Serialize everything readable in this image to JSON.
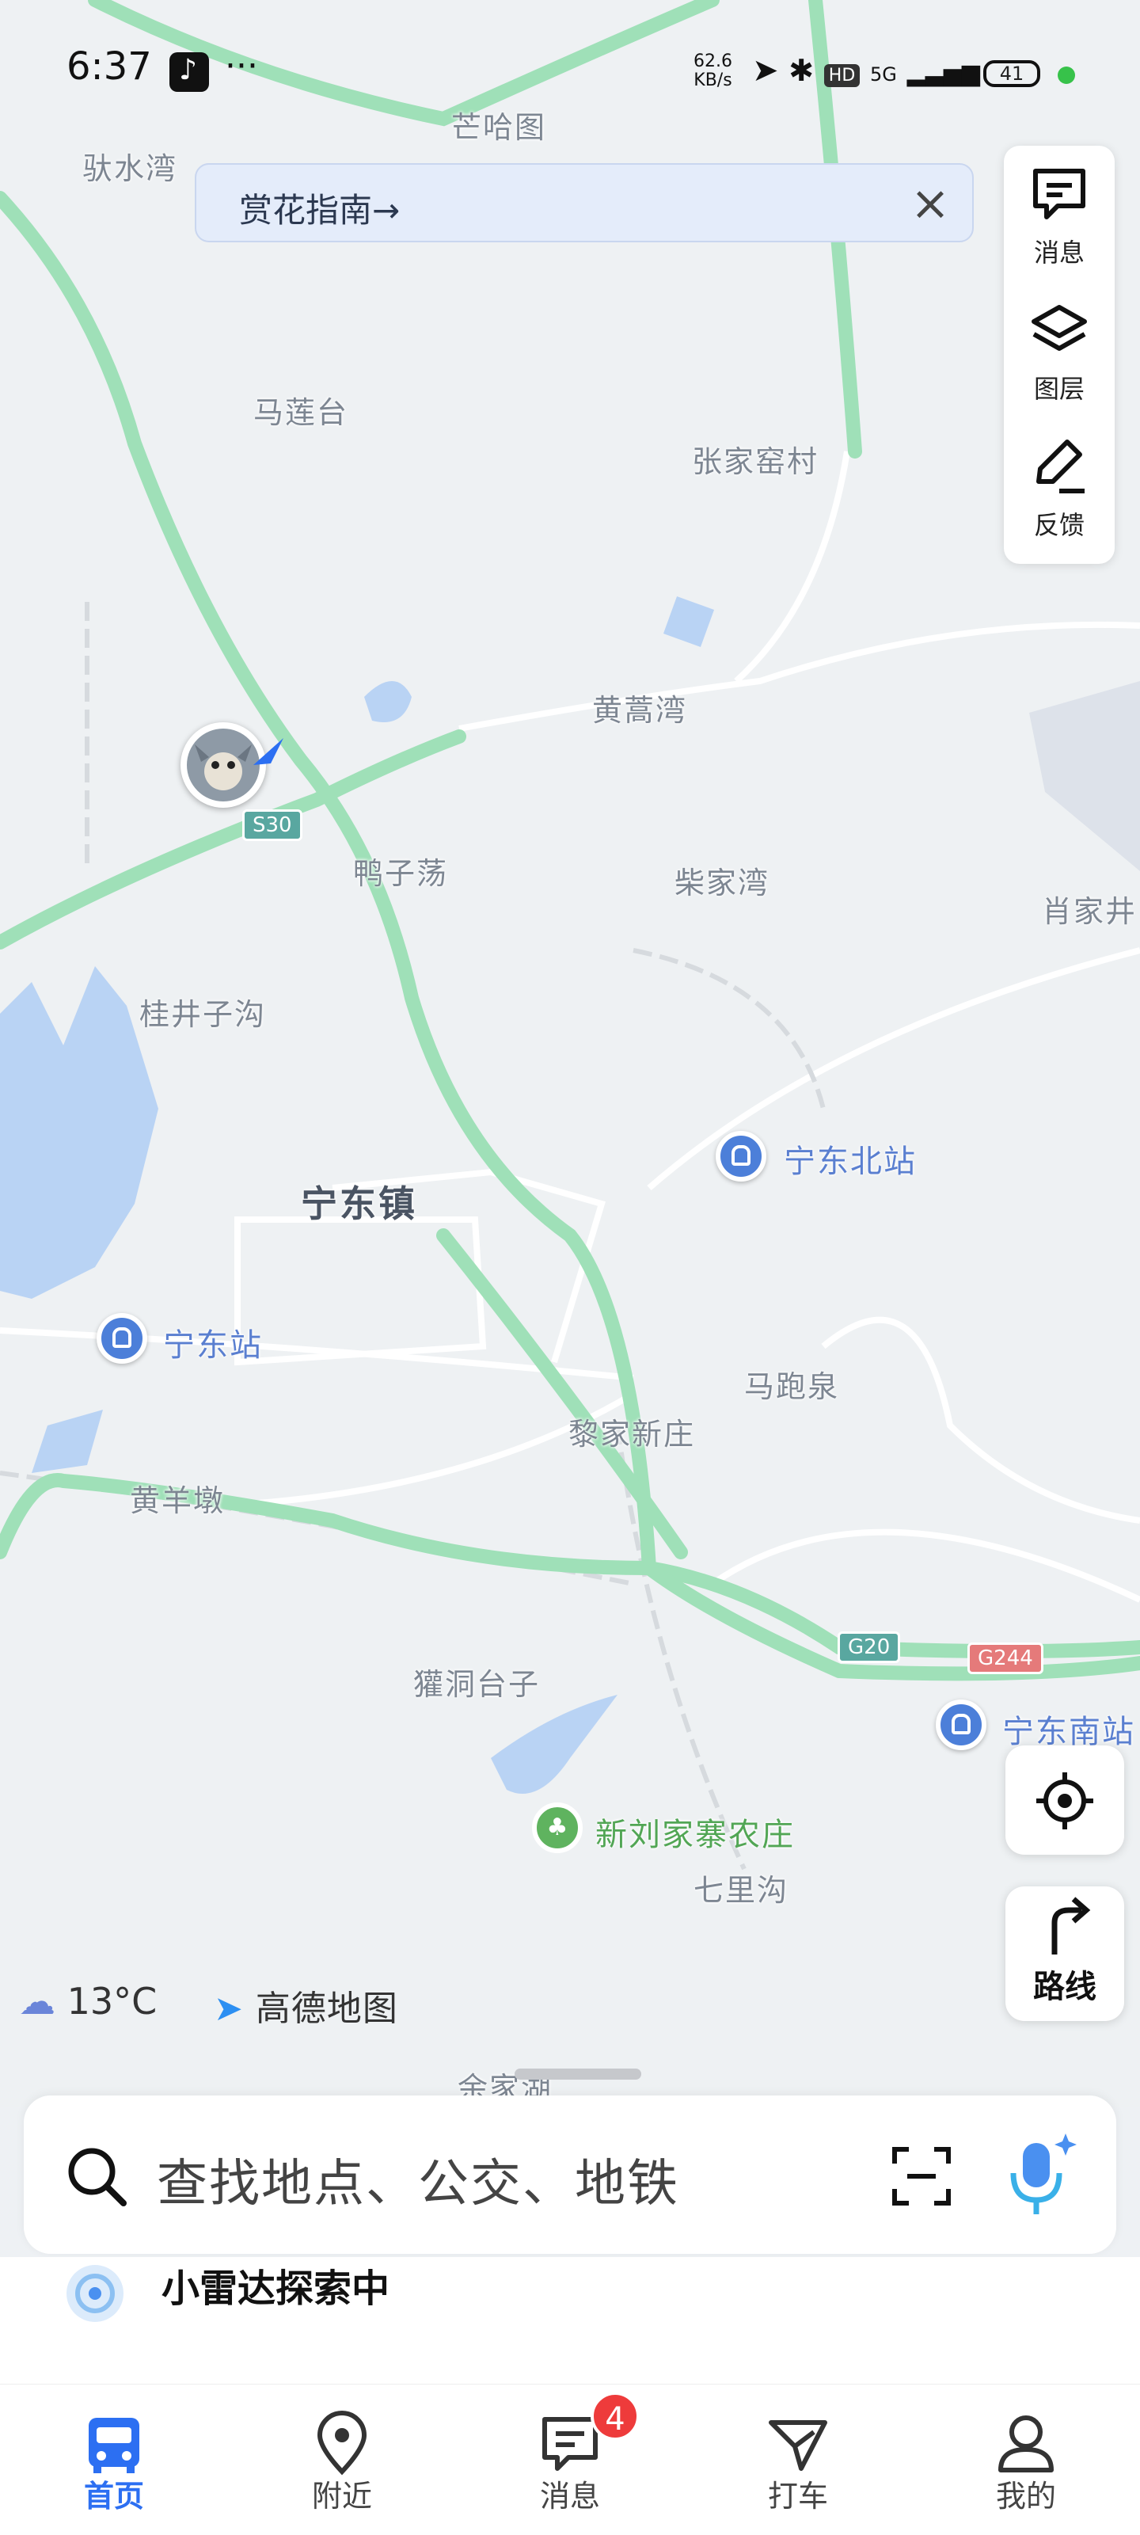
{
  "status_bar": {
    "time": "6:37",
    "more": "···",
    "net_speed_value": "62.6",
    "net_speed_unit": "KB/s",
    "hd": "HD",
    "network": "5G",
    "battery": "41"
  },
  "banner": {
    "text": "赏花指南→"
  },
  "side_panel": {
    "items": [
      {
        "label": "消息",
        "icon": "message-icon"
      },
      {
        "label": "图层",
        "icon": "layers-icon"
      },
      {
        "label": "反馈",
        "icon": "feedback-icon"
      }
    ]
  },
  "map": {
    "labels": [
      {
        "key": "l1",
        "text": "芒哈图"
      },
      {
        "key": "l2",
        "text": "驮水湾"
      },
      {
        "key": "l3",
        "text": "马莲台"
      },
      {
        "key": "l4",
        "text": "张家窑村"
      },
      {
        "key": "l5",
        "text": "黄蒿湾"
      },
      {
        "key": "l6",
        "text": "鸭子荡"
      },
      {
        "key": "l7",
        "text": "柴家湾"
      },
      {
        "key": "l8",
        "text": "肖家井"
      },
      {
        "key": "l9",
        "text": "桂井子沟"
      },
      {
        "key": "l10",
        "text": "马跑泉"
      },
      {
        "key": "l11",
        "text": "黎家新庄"
      },
      {
        "key": "l12",
        "text": "黄羊墩"
      },
      {
        "key": "l13",
        "text": "獾洞台子"
      },
      {
        "key": "l14",
        "text": "七里沟"
      },
      {
        "key": "l15",
        "text": "余家湖"
      }
    ],
    "town": "宁东镇",
    "stations": [
      "宁东北站",
      "宁东站",
      "宁东南站"
    ],
    "poi_farm": "新刘家寨农庄",
    "shields": [
      "S30",
      "G20",
      "G244"
    ]
  },
  "controls": {
    "locate_icon": "locate-icon",
    "route_label": "路线"
  },
  "weather": {
    "temp": "13°C",
    "icon": "cloud-icon"
  },
  "brand": {
    "name": "高德地图"
  },
  "search": {
    "placeholder": "查找地点、公交、地铁"
  },
  "radar": {
    "text": "小雷达探索中"
  },
  "tabs": [
    {
      "label": "首页",
      "icon": "bus-icon",
      "active": true
    },
    {
      "label": "附近",
      "icon": "location-pin-icon"
    },
    {
      "label": "消息",
      "icon": "message-icon"
    },
    {
      "label": "打车",
      "icon": "taxi-icon"
    },
    {
      "label": "我的",
      "icon": "profile-icon"
    }
  ],
  "message_badge": "4",
  "colors": {
    "accent": "#2c6ff2",
    "highway": "#9fe0b8",
    "water": "#b9d3f4",
    "badge": "#ee3b3b"
  }
}
